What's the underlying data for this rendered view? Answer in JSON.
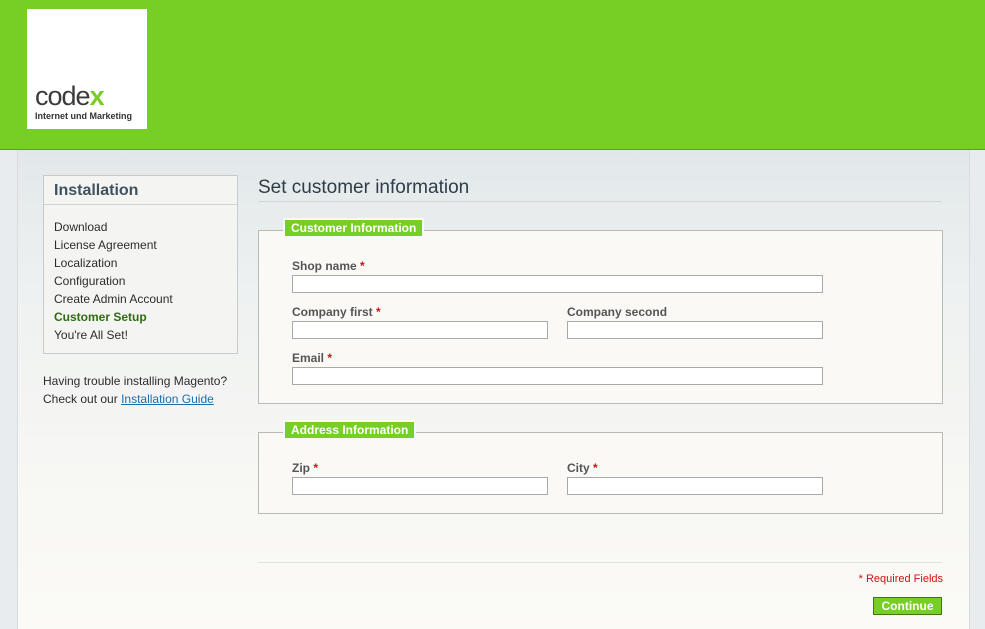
{
  "brand": {
    "logo_word": "code",
    "logo_x": "x",
    "logo_subtitle": "Internet und Marketing",
    "accent_color": "#77ce25"
  },
  "sidebar": {
    "title": "Installation",
    "items": [
      {
        "label": "Download",
        "active": false
      },
      {
        "label": "License Agreement",
        "active": false
      },
      {
        "label": "Localization",
        "active": false
      },
      {
        "label": "Configuration",
        "active": false
      },
      {
        "label": "Create Admin Account",
        "active": false
      },
      {
        "label": "Customer Setup",
        "active": true
      },
      {
        "label": "You're All Set!",
        "active": false
      }
    ],
    "help_line1": "Having trouble installing Magento?",
    "help_line2": "Check out our",
    "help_link": "Installation Guide"
  },
  "main": {
    "title": "Set customer information",
    "customer_section": {
      "legend": "Customer Information",
      "shop_name_label": "Shop name",
      "company_first_label": "Company first",
      "company_second_label": "Company second",
      "email_label": "Email"
    },
    "address_section": {
      "legend": "Address Information",
      "zip_label": "Zip",
      "city_label": "City"
    },
    "required_marker": "*",
    "required_note": "* Required Fields",
    "continue_label": "Continue"
  }
}
